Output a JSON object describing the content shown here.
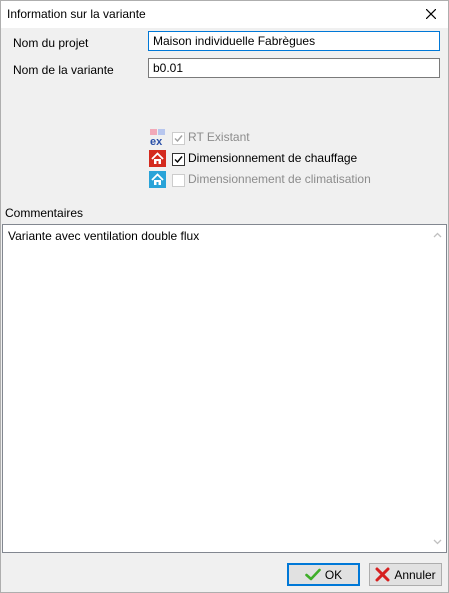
{
  "window": {
    "title": "Information sur la variante",
    "close_icon": "close-icon"
  },
  "form": {
    "project_label": "Nom du projet",
    "project_value": "Maison individuelle Fabrègues",
    "variant_label": "Nom de la variante",
    "variant_value": "b0.01"
  },
  "options": [
    {
      "label": "RT Existant",
      "checked": true,
      "enabled": false,
      "icon": "rt-existant-icon",
      "icon_text": "ex"
    },
    {
      "label": "Dimensionnement de chauffage",
      "checked": true,
      "enabled": true,
      "icon": "house-heating-icon"
    },
    {
      "label": "Dimensionnement de climatisation",
      "checked": false,
      "enabled": false,
      "icon": "house-cooling-icon"
    }
  ],
  "comments": {
    "label": "Commentaires",
    "text": "Variante avec ventilation double flux"
  },
  "buttons": {
    "ok_label": "OK",
    "cancel_label": "Annuler"
  },
  "colors": {
    "accent": "#0078d7",
    "heating_icon": "#d42a1e",
    "cooling_icon": "#29a3d8",
    "ok_check": "#3fae2a",
    "cancel_x": "#d62020"
  }
}
